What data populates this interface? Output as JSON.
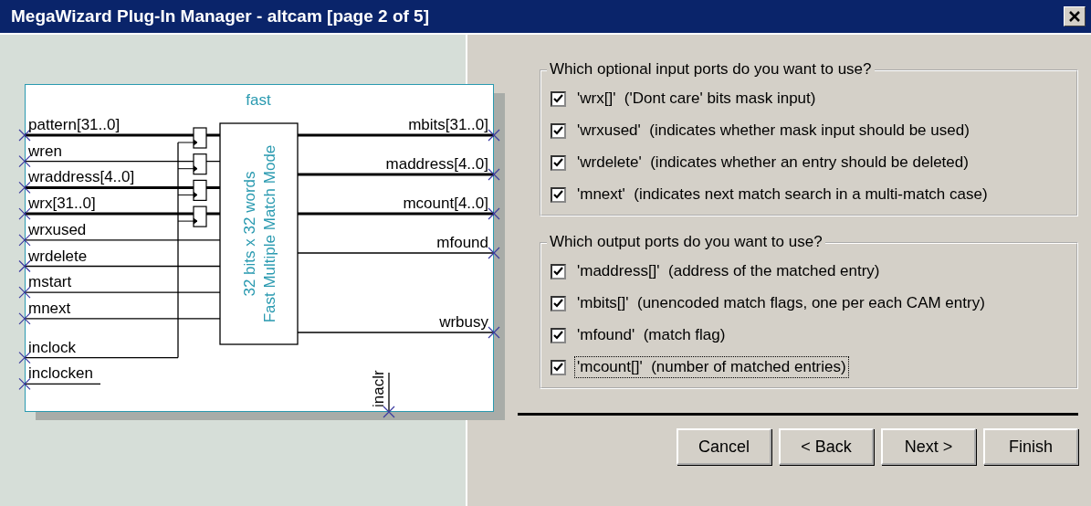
{
  "window": {
    "title": "MegaWizard Plug-In Manager - altcam [page 2 of 5]"
  },
  "diagram": {
    "title": "fast",
    "core_lines": [
      "32 bits x 32 words",
      "Fast Multiple Match Mode"
    ],
    "inputs": [
      {
        "name": "pattern[31..0]",
        "kind": "bus",
        "registered": true
      },
      {
        "name": "wren",
        "kind": "signal",
        "registered": true
      },
      {
        "name": "wraddress[4..0]",
        "kind": "bus",
        "registered": true
      },
      {
        "name": "wrx[31..0]",
        "kind": "bus",
        "registered": true
      },
      {
        "name": "wrxused",
        "kind": "signal",
        "registered": false
      },
      {
        "name": "wrdelete",
        "kind": "signal",
        "registered": false
      },
      {
        "name": "mstart",
        "kind": "signal",
        "registered": false
      },
      {
        "name": "mnext",
        "kind": "signal",
        "registered": false
      },
      {
        "name": "inclock",
        "kind": "clock"
      },
      {
        "name": "inclocken",
        "kind": "enable"
      }
    ],
    "outputs": [
      {
        "name": "mbits[31..0]",
        "kind": "bus"
      },
      {
        "name": "maddress[4..0]",
        "kind": "bus"
      },
      {
        "name": "mcount[4..0]",
        "kind": "bus"
      },
      {
        "name": "mfound",
        "kind": "signal"
      },
      {
        "name": "wrbusy",
        "kind": "signal"
      }
    ],
    "bottom_port": "inaclr"
  },
  "groups": [
    {
      "legend": "Which optional input ports do you want to use?",
      "items": [
        {
          "label": "'wrx[]'  ('Dont care' bits mask input)",
          "checked": true,
          "focused": false
        },
        {
          "label": "'wrxused'  (indicates whether mask input should be used)",
          "checked": true,
          "focused": false
        },
        {
          "label": "'wrdelete'  (indicates whether an entry should be deleted)",
          "checked": true,
          "focused": false
        },
        {
          "label": "'mnext'  (indicates next match search in a multi-match case)",
          "checked": true,
          "focused": false
        }
      ]
    },
    {
      "legend": "Which output ports do you want to use?",
      "items": [
        {
          "label": "'maddress[]'  (address of the matched entry)",
          "checked": true,
          "focused": false
        },
        {
          "label": "'mbits[]'  (unencoded match flags, one per each CAM entry)",
          "checked": true,
          "focused": false
        },
        {
          "label": "'mfound'  (match flag)",
          "checked": true,
          "focused": false
        },
        {
          "label": "'mcount[]'  (number of matched entries)",
          "checked": true,
          "focused": true
        }
      ]
    }
  ],
  "buttons": [
    "Cancel",
    "< Back",
    "Next >",
    "Finish"
  ]
}
